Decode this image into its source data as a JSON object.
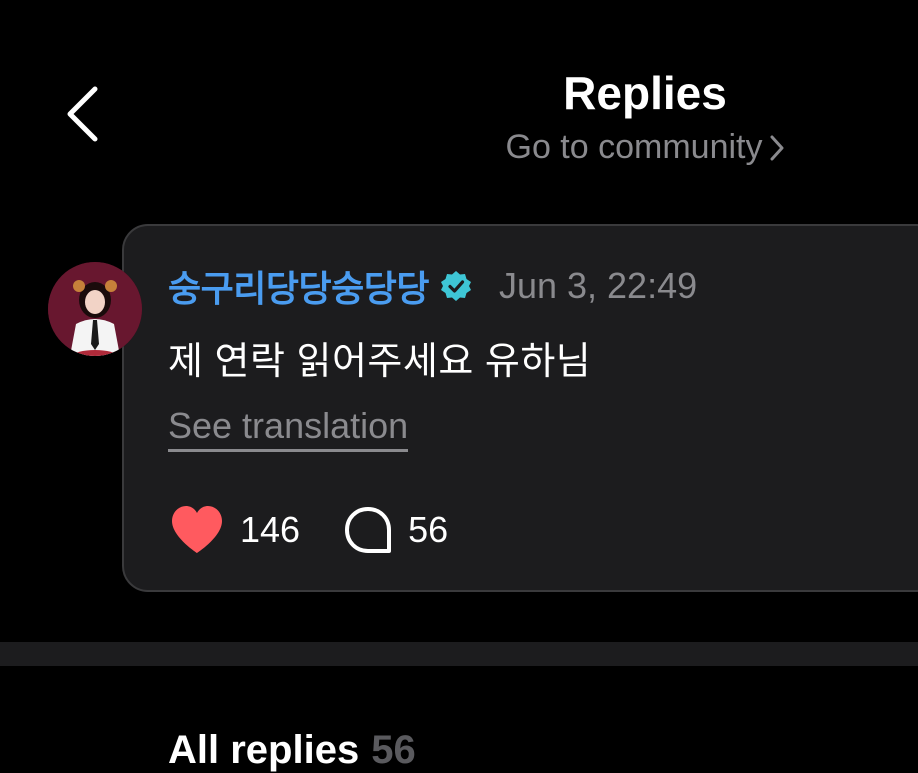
{
  "header": {
    "title": "Replies",
    "subtitle_link": "Go to community",
    "back_icon": "chevron-left-icon"
  },
  "post": {
    "username": "숭구리당당숭당당",
    "verified_icon": "verified-badge-icon",
    "timestamp": "Jun 3, 22:49",
    "message": "제 연락 읽어주세요 유하님",
    "translate_label": "See translation",
    "likes": "146",
    "comments": "56",
    "like_icon": "heart-icon",
    "comment_icon": "comment-bubble-icon"
  },
  "replies_section": {
    "label": "All replies",
    "count": "56"
  },
  "colors": {
    "background": "#000000",
    "card": "#1c1c1e",
    "accent_blue": "#4a9cf0",
    "verified_badge": "#3ec6d6",
    "heart": "#ff5a5f",
    "muted_text": "#8a8a8e"
  }
}
